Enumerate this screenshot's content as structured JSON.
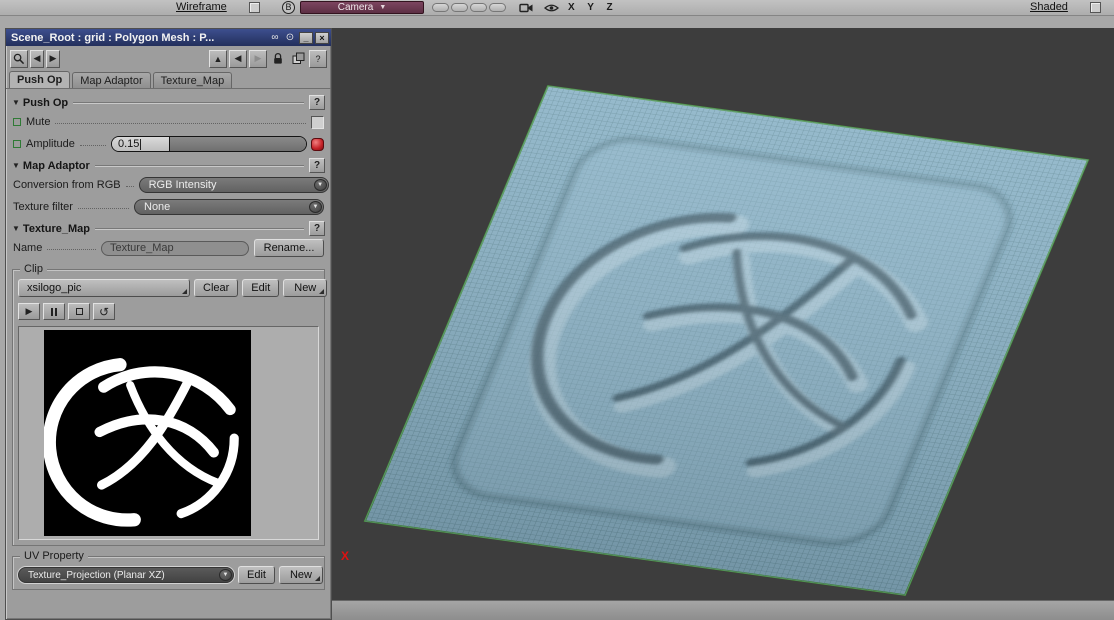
{
  "topbar": {
    "wireframe_label": "Wireframe",
    "viewport_b_label": "B",
    "camera_label": "Camera",
    "axis_letters": "X Y Z",
    "shaded_label": "Shaded"
  },
  "icons": {
    "combo_arrow": "▼",
    "dropdown_arrow": "▼",
    "collapse_arrow": "▼",
    "nav_left": "◀",
    "nav_right": "▶",
    "nav_up": "▲",
    "play": "▶",
    "loop": "↺",
    "minimize": "_",
    "close": "×",
    "link": "∞",
    "focus": "⊙",
    "help": "?"
  },
  "panel": {
    "title": "Scene_Root : grid : Polygon Mesh : P...",
    "tabs": [
      {
        "label": "Push Op"
      },
      {
        "label": "Map Adaptor"
      },
      {
        "label": "Texture_Map"
      }
    ],
    "push_op": {
      "title": "Push Op",
      "mute_label": "Mute",
      "amplitude_label": "Amplitude",
      "amplitude_value": "0.15"
    },
    "map_adaptor": {
      "title": "Map Adaptor",
      "conversion_label": "Conversion from RGB",
      "conversion_value": "RGB Intensity",
      "filter_label": "Texture filter",
      "filter_value": "None"
    },
    "texture_map": {
      "title": "Texture_Map",
      "name_label": "Name",
      "name_value": "Texture_Map",
      "rename_button": "Rename...",
      "clip_group_label": "Clip",
      "clip_value": "xsilogo_pic",
      "clear_button": "Clear",
      "edit_button": "Edit",
      "new_button": "New",
      "uv_group_label": "UV Property",
      "uv_value": "Texture_Projection (Planar XZ)",
      "uv_edit_button": "Edit",
      "uv_new_button": "New"
    }
  },
  "viewport": {
    "axis_x_label": "X",
    "bg": "#3d3d3d",
    "plane_fill": "#8ab2c6",
    "grid_color": "#69919f",
    "edge_color": "#4c9a3c",
    "emboss_dark": "#243a46",
    "emboss_light": "#cfe4ee"
  }
}
